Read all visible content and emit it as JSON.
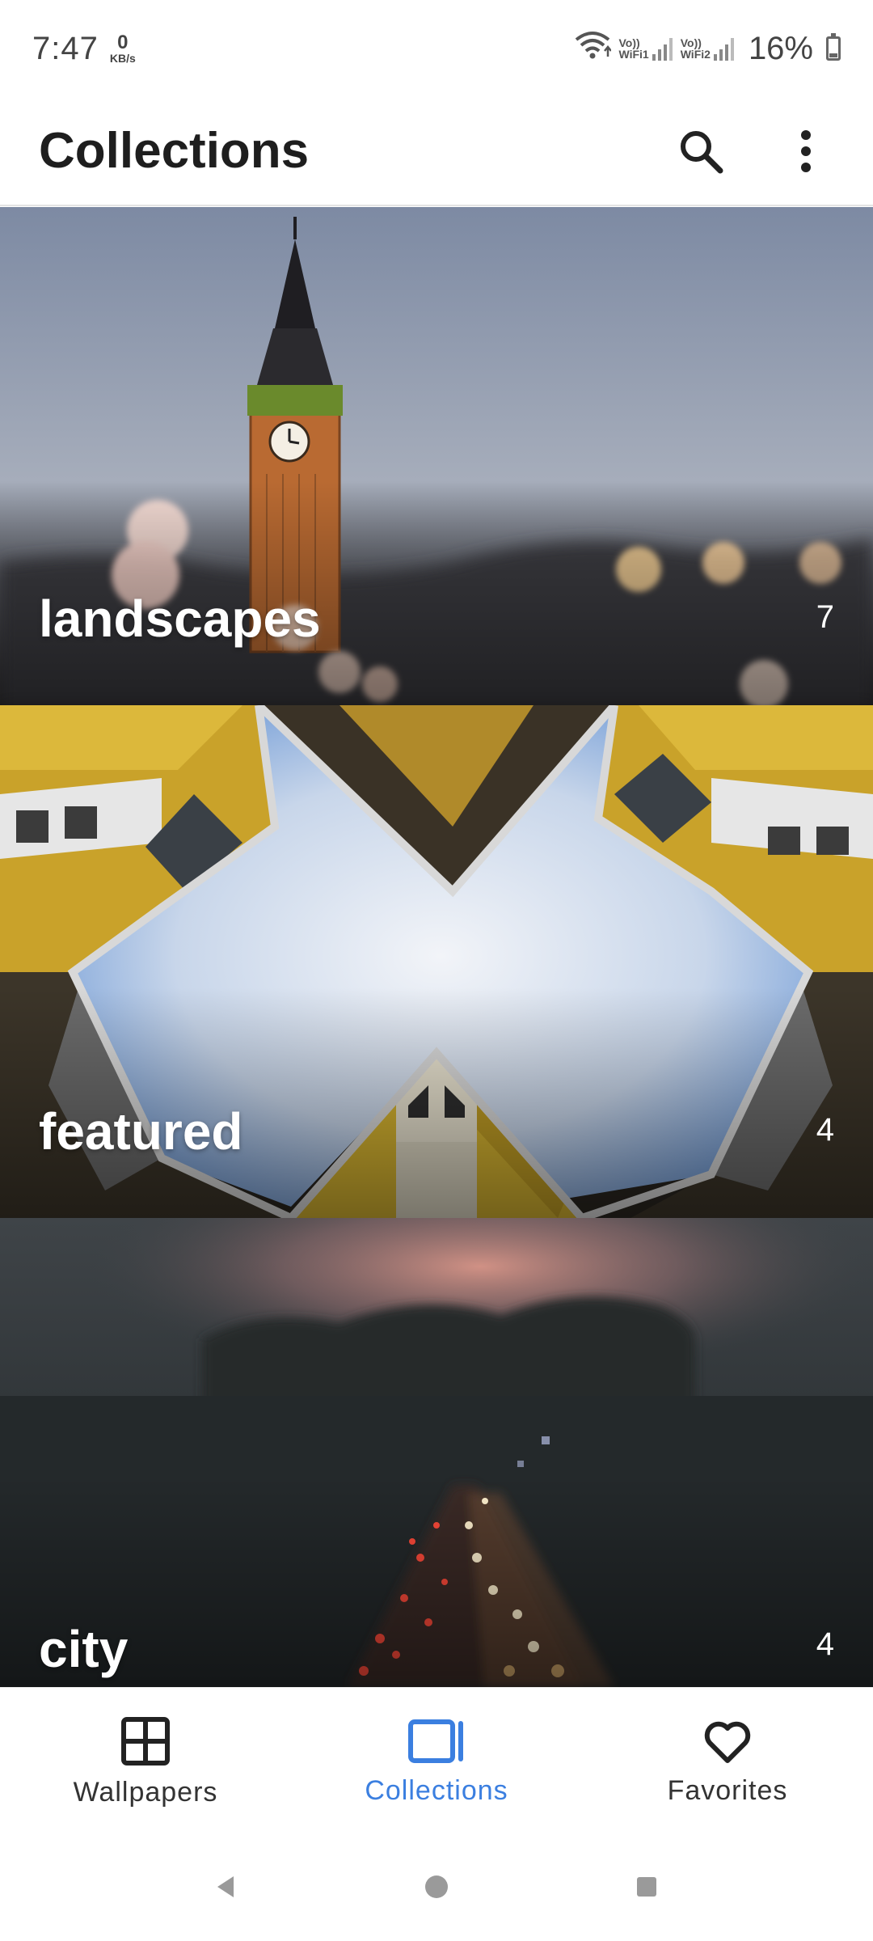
{
  "status_bar": {
    "time": "7:47",
    "net_speed_value": "0",
    "net_speed_unit": "KB/s",
    "sim1_label_top": "Vo))",
    "sim1_label_bottom": "WiFi1",
    "sim2_label_top": "Vo))",
    "sim2_label_bottom": "WiFi2",
    "battery": "16%"
  },
  "app_bar": {
    "title": "Collections",
    "search_icon": "search-icon",
    "more_icon": "more-vert-icon"
  },
  "collections": [
    {
      "name": "landscapes",
      "count": "7"
    },
    {
      "name": "featured",
      "count": "4"
    },
    {
      "name": "city",
      "count": "4"
    }
  ],
  "bottom_nav": {
    "items": [
      {
        "label": "Wallpapers",
        "icon": "grid-icon",
        "active": false
      },
      {
        "label": "Collections",
        "icon": "collections-icon",
        "active": true
      },
      {
        "label": "Favorites",
        "icon": "heart-icon",
        "active": false
      }
    ],
    "active_color": "#3b7fe0"
  },
  "system_nav": [
    "back-icon",
    "home-icon",
    "recents-icon"
  ]
}
